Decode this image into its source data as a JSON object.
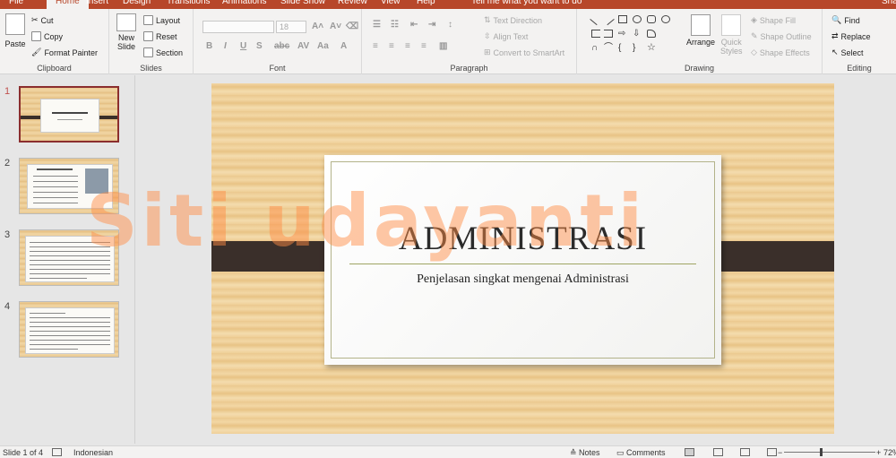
{
  "tabs": [
    "File",
    "Home",
    "Insert",
    "Design",
    "Transitions",
    "Animations",
    "Slide Show",
    "Review",
    "View",
    "Help",
    "Tell me what you want to do",
    "Sha"
  ],
  "ribbon": {
    "clipboard": {
      "paste": "Paste",
      "cut": "Cut",
      "copy": "Copy",
      "format_painter": "Format Painter",
      "label": "Clipboard"
    },
    "slides": {
      "new_slide": "New",
      "new_slide2": "Slide",
      "layout": "Layout",
      "reset": "Reset",
      "section": "Section",
      "label": "Slides"
    },
    "font": {
      "size": "18",
      "label": "Font"
    },
    "paragraph": {
      "text_direction": "Text Direction",
      "align_text": "Align Text",
      "convert": "Convert to SmartArt",
      "label": "Paragraph"
    },
    "drawing": {
      "arrange": "Arrange",
      "quick_styles": "Quick",
      "quick_styles2": "Styles",
      "shape_fill": "Shape Fill",
      "shape_outline": "Shape Outline",
      "shape_effects": "Shape Effects",
      "label": "Drawing"
    },
    "editing": {
      "find": "Find",
      "replace": "Replace",
      "select": "Select",
      "label": "Editing"
    }
  },
  "thumbnails": [
    "1",
    "2",
    "3",
    "4"
  ],
  "slide": {
    "title": "ADMINISTRASI",
    "subtitle": "Penjelasan singkat mengenai Administrasi",
    "watermark": "Siti udayanti"
  },
  "status": {
    "slide_info": "Slide 1 of 4",
    "language": "Indonesian",
    "notes": "Notes",
    "comments": "Comments",
    "zoom": "72%"
  }
}
